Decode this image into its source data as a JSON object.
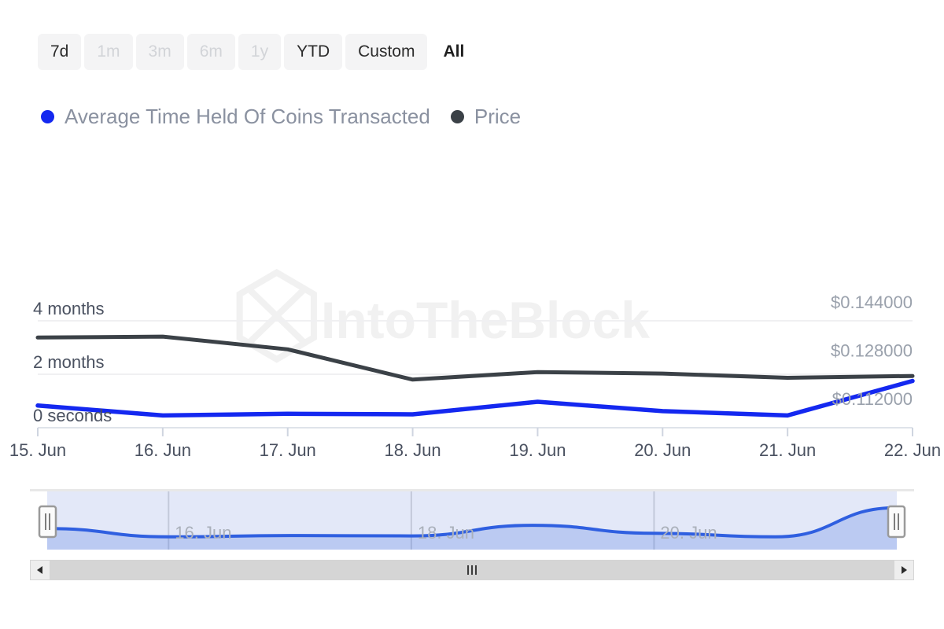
{
  "range_selector": {
    "buttons": [
      {
        "label": "7d",
        "state": "enabled"
      },
      {
        "label": "1m",
        "state": "disabled"
      },
      {
        "label": "3m",
        "state": "disabled"
      },
      {
        "label": "6m",
        "state": "disabled"
      },
      {
        "label": "1y",
        "state": "disabled"
      },
      {
        "label": "YTD",
        "state": "enabled"
      },
      {
        "label": "Custom",
        "state": "enabled"
      },
      {
        "label": "All",
        "state": "selected"
      }
    ]
  },
  "legend": {
    "items": [
      {
        "label": "Average Time Held Of Coins Transacted",
        "color": "#1428f0",
        "marker": "circle-marker"
      },
      {
        "label": "Price",
        "color": "#3b4147",
        "marker": "circle-marker"
      }
    ]
  },
  "watermark": {
    "text": "IntoTheBlock",
    "logo": "hexagon-logo-icon",
    "color": "#f1f1f1"
  },
  "navigator": {
    "date_labels": [
      "16. Jun",
      "18. Jun",
      "20. Jun"
    ],
    "handle_left": "nav-handle-left",
    "handle_right": "nav-handle-right",
    "series_color": "#2f5fe0",
    "fill_color": "#ccd5f2"
  },
  "scrollbar": {
    "left_arrow": "◀",
    "right_arrow": "▶"
  },
  "chart_data": {
    "type": "line",
    "title": "",
    "xlabel": "",
    "grid": true,
    "legend_position": "top-left",
    "x": [
      "15. Jun",
      "16. Jun",
      "17. Jun",
      "18. Jun",
      "19. Jun",
      "20. Jun",
      "21. Jun",
      "22. Jun"
    ],
    "axes": {
      "left": {
        "label": "Average Time Held Of Coins Transacted",
        "ticks": [
          "0 seconds",
          "2 months",
          "4 months"
        ],
        "tick_values": [
          0,
          2,
          4
        ],
        "unit": "months",
        "ylim": [
          0,
          4.8
        ]
      },
      "right": {
        "label": "Price",
        "ticks": [
          "$0.112000",
          "$0.128000",
          "$0.144000"
        ],
        "tick_values": [
          0.112,
          0.128,
          0.144
        ],
        "unit": "USD",
        "ylim": [
          0.1068,
          0.1492
        ]
      }
    },
    "series": [
      {
        "name": "Average Time Held Of Coins Transacted",
        "color": "#1428f0",
        "axis": "left",
        "unit": "months",
        "values": [
          0.83,
          0.46,
          0.52,
          0.5,
          0.97,
          0.62,
          0.46,
          1.75
        ]
      },
      {
        "name": "Price",
        "color": "#3b4147",
        "axis": "right",
        "unit": "USD",
        "values": [
          0.1366,
          0.1369,
          0.1327,
          0.1227,
          0.1252,
          0.1247,
          0.1233,
          0.1239
        ]
      }
    ]
  }
}
